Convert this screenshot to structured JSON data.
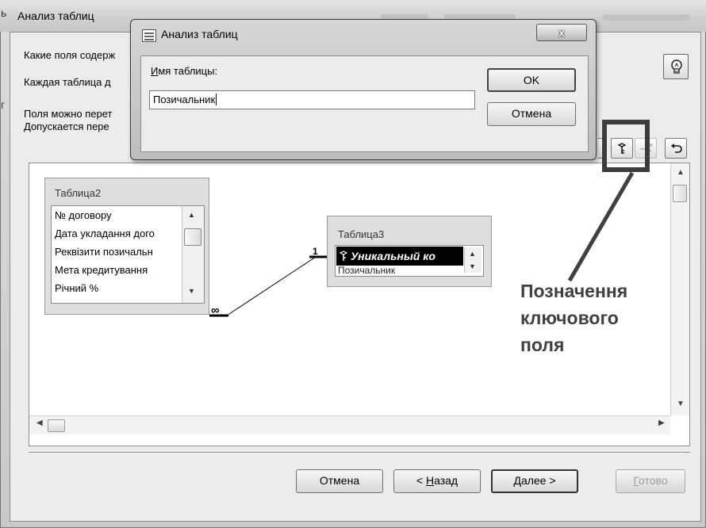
{
  "wizard": {
    "title": "Анализ таблиц",
    "line1": "Какие поля содерж",
    "line2": "Каждая таблица д",
    "line3": "Поля можно перет",
    "line4": "Допускается пере",
    "edge_glyph": "г",
    "title_glyph": "ь"
  },
  "toolbar": {
    "key_button": "set-key-icon",
    "key_off_button": "remove-key-icon",
    "undo_button": "undo-icon"
  },
  "tables": {
    "table2": {
      "title": "Таблица2",
      "fields": [
        "№ договору",
        "Дата укладання дого",
        "Реквізити позичальн",
        "Мета кредитування",
        "Річний %"
      ]
    },
    "table3": {
      "title": "Таблица3",
      "key_field": "Уникальный ко",
      "next_field": "Позичальник"
    }
  },
  "relationship": {
    "one_label": "1",
    "many_label": "∞"
  },
  "annotation": {
    "line1": "Позначення",
    "line2": "ключового",
    "line3": "поля"
  },
  "buttons": {
    "cancel": "Отмена",
    "back_prefix": "< ",
    "back_mnemonic": "Н",
    "back_rest": "азад",
    "next_mnemonic": "Д",
    "next_rest": "алее >",
    "finish_mnemonic": "Г",
    "finish_rest": "отово"
  },
  "dialog": {
    "title": "Анализ таблиц",
    "close": "x",
    "label_mnemonic": "И",
    "label_rest": "мя таблицы:",
    "input_value": "Позичальник",
    "ok": "OK",
    "cancel": "Отмена"
  },
  "colors": {
    "highlight_frame": "#3c3c3c",
    "selection": "#000000"
  }
}
